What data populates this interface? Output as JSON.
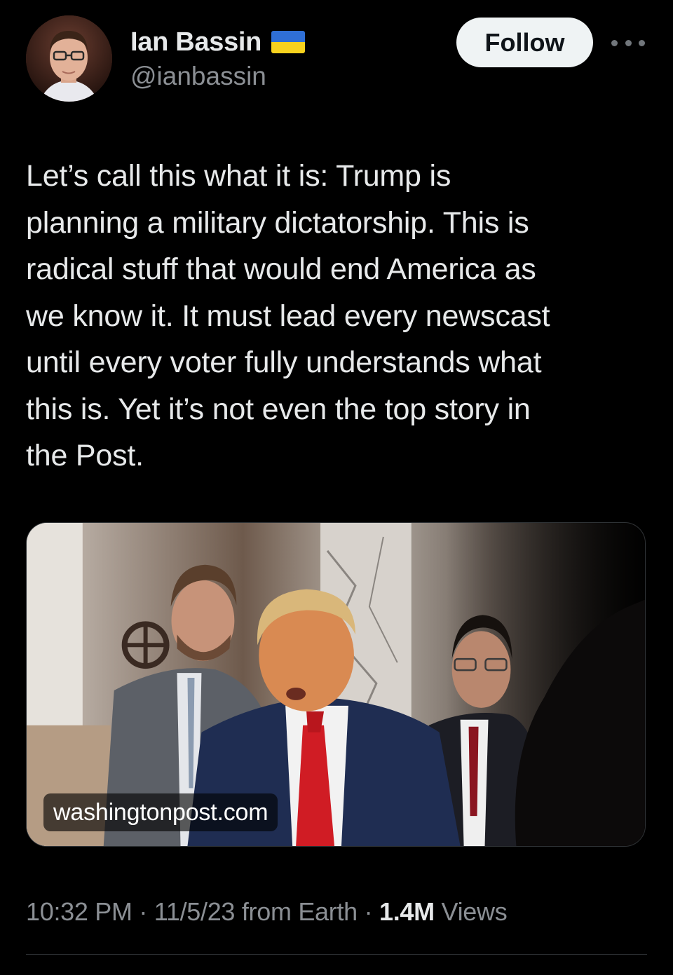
{
  "author": {
    "display_name": "Ian Bassin",
    "handle": "@ianbassin",
    "badge_icon": "ukraine-flag-icon",
    "flag_colors": {
      "top": "#2f6fd6",
      "bottom": "#f7d21e"
    }
  },
  "actions": {
    "follow_label": "Follow",
    "more_icon": "more-horizontal-icon"
  },
  "tweet": {
    "text": "Let’s call this what it is: Trump is\nplanning a military dictatorship. This is\nradical stuff that would end America as\nwe know it. It must lead every newscast\nuntil every voter fully understands what\nthis is. Yet it’s not even the top story in\nthe Post."
  },
  "link_card": {
    "domain": "washingtonpost.com"
  },
  "meta": {
    "time": "10:32 PM",
    "separator": " · ",
    "date": "11/5/23",
    "source": " from Earth",
    "views_count": "1.4M",
    "views_label": " Views"
  },
  "colors": {
    "background": "#000000",
    "text_primary": "#e7e9ea",
    "text_secondary": "#8b8f94",
    "follow_button_bg": "#eff3f4",
    "divider": "#2f3336"
  }
}
